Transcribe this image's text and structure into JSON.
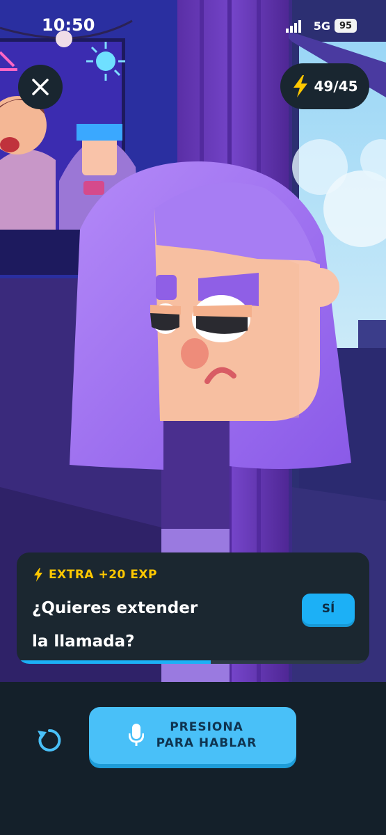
{
  "status_bar": {
    "time": "10:50",
    "network": "5G",
    "battery": "95"
  },
  "top": {
    "close_icon": "close-icon",
    "energy": {
      "icon": "lightning-icon",
      "count": "49/45"
    }
  },
  "scene": {
    "character": "Lily",
    "colors": {
      "hair": "#9b6bf0",
      "skin": "#f9c3a9",
      "curtain": "#6a3db8"
    }
  },
  "prompt_card": {
    "bonus_label": "EXTRA +20 EXP",
    "question": "¿Quieres extender\nla llamada?",
    "yes_label": "SÍ",
    "progress_fraction": 0.55
  },
  "bottom_bar": {
    "replay_icon": "replay-icon",
    "talk_button": {
      "label": "PRESIONA\nPARA HABLAR",
      "icon": "microphone-icon"
    }
  },
  "colors": {
    "accent_blue": "#1cb0f6",
    "gold": "#ffc800",
    "panel": "#1b2730"
  }
}
